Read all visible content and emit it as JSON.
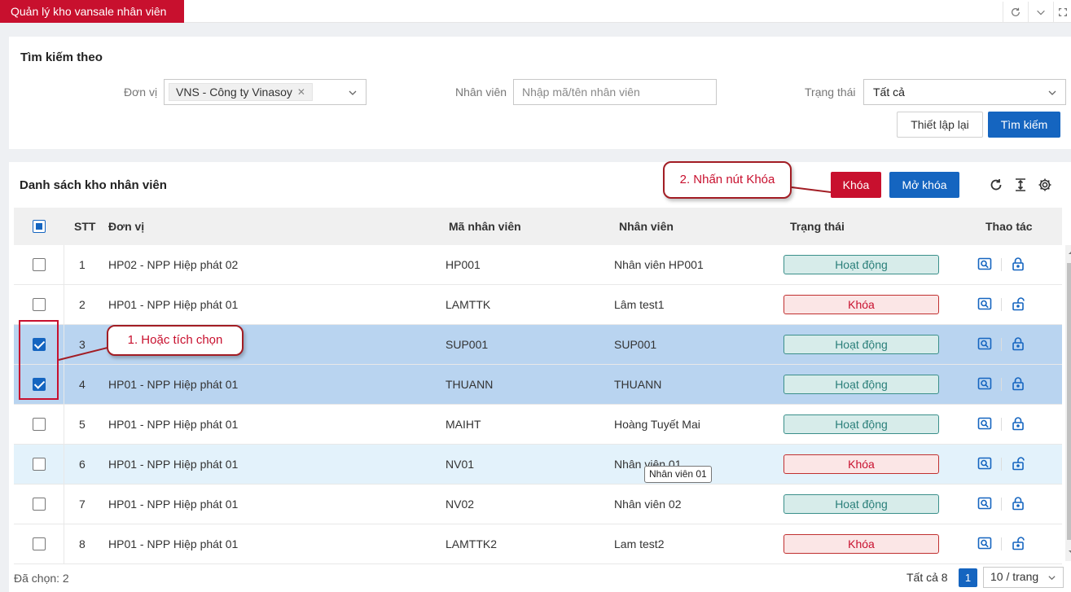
{
  "app": {
    "tab_title": "Quản lý kho vansale nhân viên"
  },
  "search": {
    "title": "Tìm kiếm theo",
    "don_vi_label": "Đơn vị",
    "don_vi_tag": "VNS - Công ty Vinasoy",
    "nhan_vien_label": "Nhân viên",
    "nhan_vien_placeholder": "Nhập mã/tên nhân viên",
    "trang_thai_label": "Trạng thái",
    "trang_thai_value": "Tất cả",
    "reset_label": "Thiết lập lại",
    "search_label": "Tìm kiếm"
  },
  "list": {
    "title": "Danh sách kho nhân viên",
    "lock_label": "Khóa",
    "unlock_label": "Mở khóa",
    "columns": {
      "stt": "STT",
      "don_vi": "Đơn vị",
      "ma_nv": "Mã nhân viên",
      "nhan_vien": "Nhân viên",
      "trang_thai": "Trạng thái",
      "thao_tac": "Thao tác"
    },
    "rows": [
      {
        "stt": "1",
        "don_vi": "HP02 - NPP Hiệp phát 02",
        "ma_nv": "HP001",
        "nhan_vien": "Nhân viên HP001",
        "trang_thai": "Hoạt động",
        "status": "active",
        "checked": false
      },
      {
        "stt": "2",
        "don_vi": "HP01 - NPP Hiệp phát 01",
        "ma_nv": "LAMTTK",
        "nhan_vien": "Lâm test1",
        "trang_thai": "Khóa",
        "status": "locked",
        "checked": false
      },
      {
        "stt": "3",
        "don_vi": "",
        "ma_nv": "SUP001",
        "nhan_vien": "SUP001",
        "trang_thai": "Hoạt động",
        "status": "active",
        "checked": true
      },
      {
        "stt": "4",
        "don_vi": "HP01 - NPP Hiệp phát 01",
        "ma_nv": "THUANN",
        "nhan_vien": "THUANN",
        "trang_thai": "Hoạt động",
        "status": "active",
        "checked": true
      },
      {
        "stt": "5",
        "don_vi": "HP01 - NPP Hiệp phát 01",
        "ma_nv": "MAIHT",
        "nhan_vien": "Hoàng Tuyết Mai",
        "trang_thai": "Hoạt động",
        "status": "active",
        "checked": false
      },
      {
        "stt": "6",
        "don_vi": "HP01 - NPP Hiệp phát 01",
        "ma_nv": "NV01",
        "nhan_vien": "Nhân viên 01",
        "trang_thai": "Khóa",
        "status": "locked",
        "checked": false
      },
      {
        "stt": "7",
        "don_vi": "HP01 - NPP Hiệp phát 01",
        "ma_nv": "NV02",
        "nhan_vien": "Nhân viên 02",
        "trang_thai": "Hoạt động",
        "status": "active",
        "checked": false
      },
      {
        "stt": "8",
        "don_vi": "HP01 - NPP Hiệp phát 01",
        "ma_nv": "LAMTTK2",
        "nhan_vien": "Lam test2",
        "trang_thai": "Khóa",
        "status": "locked",
        "checked": false
      }
    ]
  },
  "tooltip": "Nhân viên 01",
  "footer": {
    "selected": "Đã chọn: 2",
    "total": "Tất cả 8",
    "page": "1",
    "page_size": "10 / trang"
  },
  "annotations": {
    "step1": "1. Hoặc tích chọn",
    "step2": "2. Nhấn nút Khóa"
  },
  "colors": {
    "brand_red": "#c8102e",
    "primary_blue": "#1565c0",
    "selected_row": "#b9d4f0"
  }
}
